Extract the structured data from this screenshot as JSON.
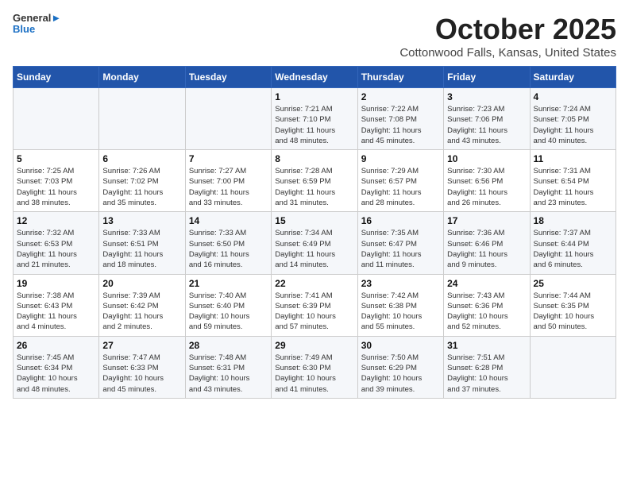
{
  "header": {
    "logo_general": "General",
    "logo_blue": "Blue",
    "title": "October 2025",
    "subtitle": "Cottonwood Falls, Kansas, United States"
  },
  "weekdays": [
    "Sunday",
    "Monday",
    "Tuesday",
    "Wednesday",
    "Thursday",
    "Friday",
    "Saturday"
  ],
  "weeks": [
    [
      {
        "day": "",
        "detail": ""
      },
      {
        "day": "",
        "detail": ""
      },
      {
        "day": "",
        "detail": ""
      },
      {
        "day": "1",
        "detail": "Sunrise: 7:21 AM\nSunset: 7:10 PM\nDaylight: 11 hours\nand 48 minutes."
      },
      {
        "day": "2",
        "detail": "Sunrise: 7:22 AM\nSunset: 7:08 PM\nDaylight: 11 hours\nand 45 minutes."
      },
      {
        "day": "3",
        "detail": "Sunrise: 7:23 AM\nSunset: 7:06 PM\nDaylight: 11 hours\nand 43 minutes."
      },
      {
        "day": "4",
        "detail": "Sunrise: 7:24 AM\nSunset: 7:05 PM\nDaylight: 11 hours\nand 40 minutes."
      }
    ],
    [
      {
        "day": "5",
        "detail": "Sunrise: 7:25 AM\nSunset: 7:03 PM\nDaylight: 11 hours\nand 38 minutes."
      },
      {
        "day": "6",
        "detail": "Sunrise: 7:26 AM\nSunset: 7:02 PM\nDaylight: 11 hours\nand 35 minutes."
      },
      {
        "day": "7",
        "detail": "Sunrise: 7:27 AM\nSunset: 7:00 PM\nDaylight: 11 hours\nand 33 minutes."
      },
      {
        "day": "8",
        "detail": "Sunrise: 7:28 AM\nSunset: 6:59 PM\nDaylight: 11 hours\nand 31 minutes."
      },
      {
        "day": "9",
        "detail": "Sunrise: 7:29 AM\nSunset: 6:57 PM\nDaylight: 11 hours\nand 28 minutes."
      },
      {
        "day": "10",
        "detail": "Sunrise: 7:30 AM\nSunset: 6:56 PM\nDaylight: 11 hours\nand 26 minutes."
      },
      {
        "day": "11",
        "detail": "Sunrise: 7:31 AM\nSunset: 6:54 PM\nDaylight: 11 hours\nand 23 minutes."
      }
    ],
    [
      {
        "day": "12",
        "detail": "Sunrise: 7:32 AM\nSunset: 6:53 PM\nDaylight: 11 hours\nand 21 minutes."
      },
      {
        "day": "13",
        "detail": "Sunrise: 7:33 AM\nSunset: 6:51 PM\nDaylight: 11 hours\nand 18 minutes."
      },
      {
        "day": "14",
        "detail": "Sunrise: 7:33 AM\nSunset: 6:50 PM\nDaylight: 11 hours\nand 16 minutes."
      },
      {
        "day": "15",
        "detail": "Sunrise: 7:34 AM\nSunset: 6:49 PM\nDaylight: 11 hours\nand 14 minutes."
      },
      {
        "day": "16",
        "detail": "Sunrise: 7:35 AM\nSunset: 6:47 PM\nDaylight: 11 hours\nand 11 minutes."
      },
      {
        "day": "17",
        "detail": "Sunrise: 7:36 AM\nSunset: 6:46 PM\nDaylight: 11 hours\nand 9 minutes."
      },
      {
        "day": "18",
        "detail": "Sunrise: 7:37 AM\nSunset: 6:44 PM\nDaylight: 11 hours\nand 6 minutes."
      }
    ],
    [
      {
        "day": "19",
        "detail": "Sunrise: 7:38 AM\nSunset: 6:43 PM\nDaylight: 11 hours\nand 4 minutes."
      },
      {
        "day": "20",
        "detail": "Sunrise: 7:39 AM\nSunset: 6:42 PM\nDaylight: 11 hours\nand 2 minutes."
      },
      {
        "day": "21",
        "detail": "Sunrise: 7:40 AM\nSunset: 6:40 PM\nDaylight: 10 hours\nand 59 minutes."
      },
      {
        "day": "22",
        "detail": "Sunrise: 7:41 AM\nSunset: 6:39 PM\nDaylight: 10 hours\nand 57 minutes."
      },
      {
        "day": "23",
        "detail": "Sunrise: 7:42 AM\nSunset: 6:38 PM\nDaylight: 10 hours\nand 55 minutes."
      },
      {
        "day": "24",
        "detail": "Sunrise: 7:43 AM\nSunset: 6:36 PM\nDaylight: 10 hours\nand 52 minutes."
      },
      {
        "day": "25",
        "detail": "Sunrise: 7:44 AM\nSunset: 6:35 PM\nDaylight: 10 hours\nand 50 minutes."
      }
    ],
    [
      {
        "day": "26",
        "detail": "Sunrise: 7:45 AM\nSunset: 6:34 PM\nDaylight: 10 hours\nand 48 minutes."
      },
      {
        "day": "27",
        "detail": "Sunrise: 7:47 AM\nSunset: 6:33 PM\nDaylight: 10 hours\nand 45 minutes."
      },
      {
        "day": "28",
        "detail": "Sunrise: 7:48 AM\nSunset: 6:31 PM\nDaylight: 10 hours\nand 43 minutes."
      },
      {
        "day": "29",
        "detail": "Sunrise: 7:49 AM\nSunset: 6:30 PM\nDaylight: 10 hours\nand 41 minutes."
      },
      {
        "day": "30",
        "detail": "Sunrise: 7:50 AM\nSunset: 6:29 PM\nDaylight: 10 hours\nand 39 minutes."
      },
      {
        "day": "31",
        "detail": "Sunrise: 7:51 AM\nSunset: 6:28 PM\nDaylight: 10 hours\nand 37 minutes."
      },
      {
        "day": "",
        "detail": ""
      }
    ]
  ]
}
